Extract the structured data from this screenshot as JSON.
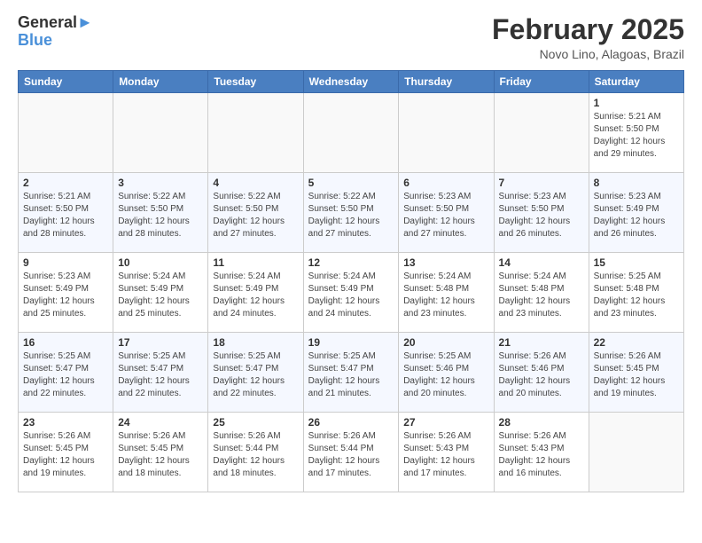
{
  "logo": {
    "line1": "General",
    "line2": "Blue"
  },
  "title": "February 2025",
  "subtitle": "Novo Lino, Alagoas, Brazil",
  "headers": [
    "Sunday",
    "Monday",
    "Tuesday",
    "Wednesday",
    "Thursday",
    "Friday",
    "Saturday"
  ],
  "weeks": [
    [
      {
        "day": "",
        "info": ""
      },
      {
        "day": "",
        "info": ""
      },
      {
        "day": "",
        "info": ""
      },
      {
        "day": "",
        "info": ""
      },
      {
        "day": "",
        "info": ""
      },
      {
        "day": "",
        "info": ""
      },
      {
        "day": "1",
        "info": "Sunrise: 5:21 AM\nSunset: 5:50 PM\nDaylight: 12 hours and 29 minutes."
      }
    ],
    [
      {
        "day": "2",
        "info": "Sunrise: 5:21 AM\nSunset: 5:50 PM\nDaylight: 12 hours and 28 minutes."
      },
      {
        "day": "3",
        "info": "Sunrise: 5:22 AM\nSunset: 5:50 PM\nDaylight: 12 hours and 28 minutes."
      },
      {
        "day": "4",
        "info": "Sunrise: 5:22 AM\nSunset: 5:50 PM\nDaylight: 12 hours and 27 minutes."
      },
      {
        "day": "5",
        "info": "Sunrise: 5:22 AM\nSunset: 5:50 PM\nDaylight: 12 hours and 27 minutes."
      },
      {
        "day": "6",
        "info": "Sunrise: 5:23 AM\nSunset: 5:50 PM\nDaylight: 12 hours and 27 minutes."
      },
      {
        "day": "7",
        "info": "Sunrise: 5:23 AM\nSunset: 5:50 PM\nDaylight: 12 hours and 26 minutes."
      },
      {
        "day": "8",
        "info": "Sunrise: 5:23 AM\nSunset: 5:49 PM\nDaylight: 12 hours and 26 minutes."
      }
    ],
    [
      {
        "day": "9",
        "info": "Sunrise: 5:23 AM\nSunset: 5:49 PM\nDaylight: 12 hours and 25 minutes."
      },
      {
        "day": "10",
        "info": "Sunrise: 5:24 AM\nSunset: 5:49 PM\nDaylight: 12 hours and 25 minutes."
      },
      {
        "day": "11",
        "info": "Sunrise: 5:24 AM\nSunset: 5:49 PM\nDaylight: 12 hours and 24 minutes."
      },
      {
        "day": "12",
        "info": "Sunrise: 5:24 AM\nSunset: 5:49 PM\nDaylight: 12 hours and 24 minutes."
      },
      {
        "day": "13",
        "info": "Sunrise: 5:24 AM\nSunset: 5:48 PM\nDaylight: 12 hours and 23 minutes."
      },
      {
        "day": "14",
        "info": "Sunrise: 5:24 AM\nSunset: 5:48 PM\nDaylight: 12 hours and 23 minutes."
      },
      {
        "day": "15",
        "info": "Sunrise: 5:25 AM\nSunset: 5:48 PM\nDaylight: 12 hours and 23 minutes."
      }
    ],
    [
      {
        "day": "16",
        "info": "Sunrise: 5:25 AM\nSunset: 5:47 PM\nDaylight: 12 hours and 22 minutes."
      },
      {
        "day": "17",
        "info": "Sunrise: 5:25 AM\nSunset: 5:47 PM\nDaylight: 12 hours and 22 minutes."
      },
      {
        "day": "18",
        "info": "Sunrise: 5:25 AM\nSunset: 5:47 PM\nDaylight: 12 hours and 22 minutes."
      },
      {
        "day": "19",
        "info": "Sunrise: 5:25 AM\nSunset: 5:47 PM\nDaylight: 12 hours and 21 minutes."
      },
      {
        "day": "20",
        "info": "Sunrise: 5:25 AM\nSunset: 5:46 PM\nDaylight: 12 hours and 20 minutes."
      },
      {
        "day": "21",
        "info": "Sunrise: 5:26 AM\nSunset: 5:46 PM\nDaylight: 12 hours and 20 minutes."
      },
      {
        "day": "22",
        "info": "Sunrise: 5:26 AM\nSunset: 5:45 PM\nDaylight: 12 hours and 19 minutes."
      }
    ],
    [
      {
        "day": "23",
        "info": "Sunrise: 5:26 AM\nSunset: 5:45 PM\nDaylight: 12 hours and 19 minutes."
      },
      {
        "day": "24",
        "info": "Sunrise: 5:26 AM\nSunset: 5:45 PM\nDaylight: 12 hours and 18 minutes."
      },
      {
        "day": "25",
        "info": "Sunrise: 5:26 AM\nSunset: 5:44 PM\nDaylight: 12 hours and 18 minutes."
      },
      {
        "day": "26",
        "info": "Sunrise: 5:26 AM\nSunset: 5:44 PM\nDaylight: 12 hours and 17 minutes."
      },
      {
        "day": "27",
        "info": "Sunrise: 5:26 AM\nSunset: 5:43 PM\nDaylight: 12 hours and 17 minutes."
      },
      {
        "day": "28",
        "info": "Sunrise: 5:26 AM\nSunset: 5:43 PM\nDaylight: 12 hours and 16 minutes."
      },
      {
        "day": "",
        "info": ""
      }
    ]
  ]
}
